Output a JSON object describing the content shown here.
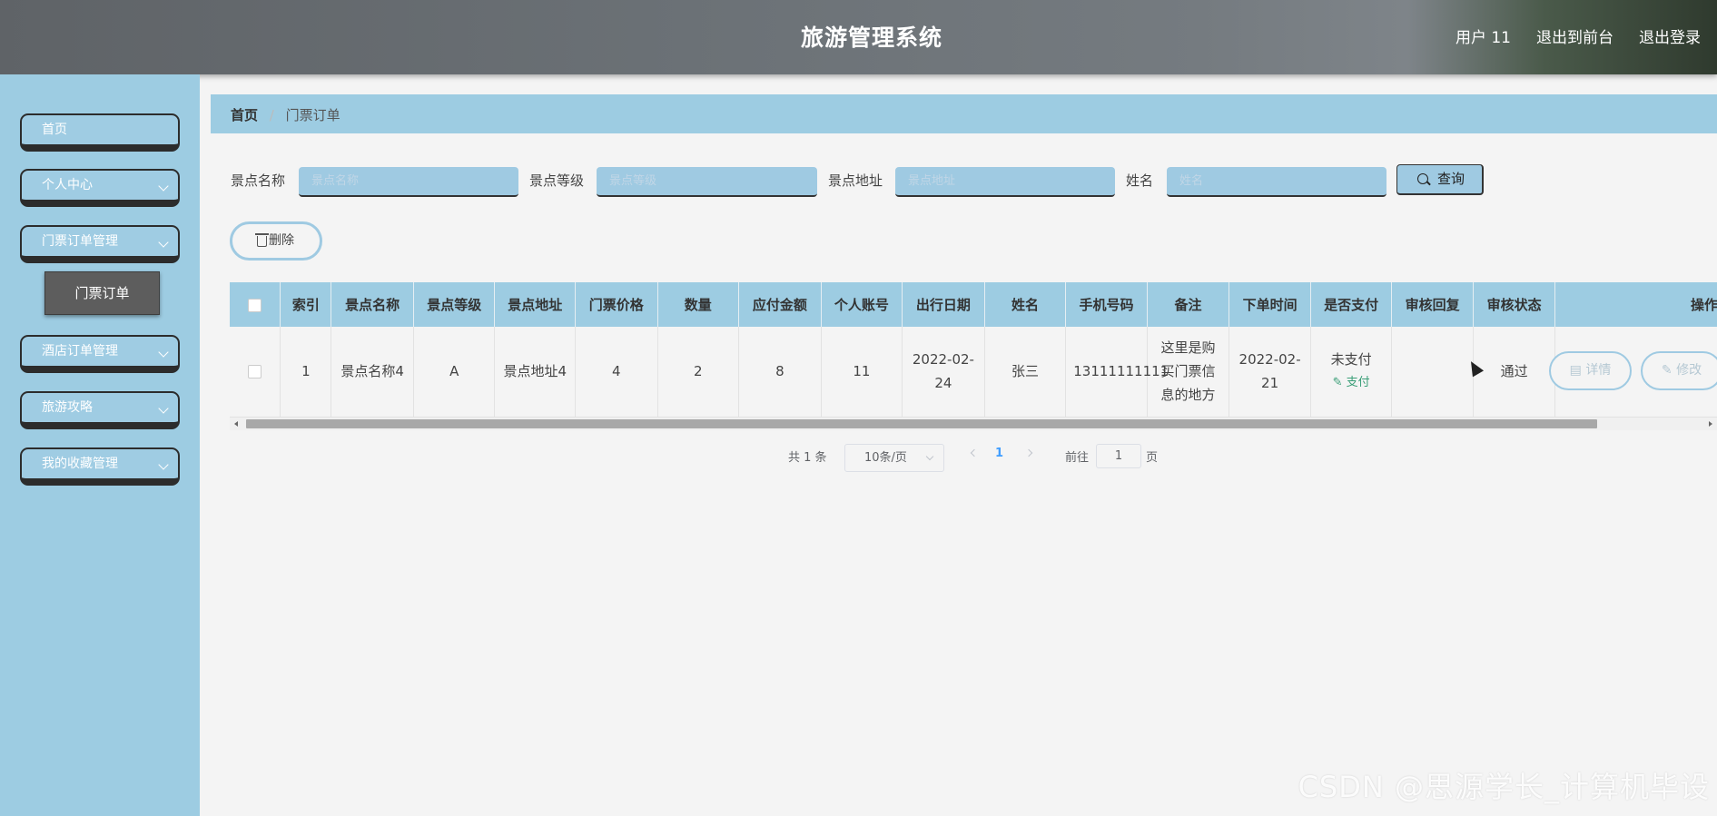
{
  "header": {
    "title": "旅游管理系统",
    "nav": [
      "用户 11",
      "退出到前台",
      "退出登录"
    ]
  },
  "sidebar": {
    "items": [
      {
        "label": "首页"
      },
      {
        "label": "个人中心"
      },
      {
        "label": "门票订单管理"
      },
      {
        "label": "酒店订单管理"
      },
      {
        "label": "旅游攻略"
      },
      {
        "label": "我的收藏管理"
      }
    ],
    "subitem": "门票订单"
  },
  "breadcrumb": {
    "home": "首页",
    "sep": "/",
    "current": "门票订单"
  },
  "search": {
    "fields": [
      {
        "label": "景点名称",
        "placeholder": "景点名称"
      },
      {
        "label": "景点等级",
        "placeholder": "景点等级"
      },
      {
        "label": "景点地址",
        "placeholder": "景点地址"
      },
      {
        "label": "姓名",
        "placeholder": "姓名"
      }
    ],
    "query_label": "查询"
  },
  "toolbar": {
    "delete_label": "删除"
  },
  "table": {
    "columns": [
      "",
      "索引",
      "景点名称",
      "景点等级",
      "景点地址",
      "门票价格",
      "数量",
      "应付金额",
      "个人账号",
      "出行日期",
      "姓名",
      "手机号码",
      "备注",
      "下单时间",
      "是否支付",
      "审核回复",
      "审核状态",
      "操作"
    ],
    "rows": [
      {
        "index": "1",
        "name": "景点名称4",
        "level": "A",
        "address": "景点地址4",
        "price": "4",
        "quantity": "2",
        "amount": "8",
        "account": "11",
        "travel_date": "2022-02-24",
        "person": "张三",
        "phone": "13111111111",
        "note": "这里是购买门票信息的地方",
        "order_time": "2022-02-21",
        "pay_status": "未支付",
        "pay_action": "支付",
        "review_reply": "",
        "review_status": "通过"
      }
    ],
    "actions": {
      "detail": "详情",
      "edit": "修改"
    }
  },
  "pagination": {
    "total": "共 1 条",
    "page_size": "10条/页",
    "current_page": "1",
    "goto_label": "前往",
    "goto_value": "1",
    "page_suffix": "页"
  },
  "watermark": "CSDN @思源学长_计算机毕设"
}
